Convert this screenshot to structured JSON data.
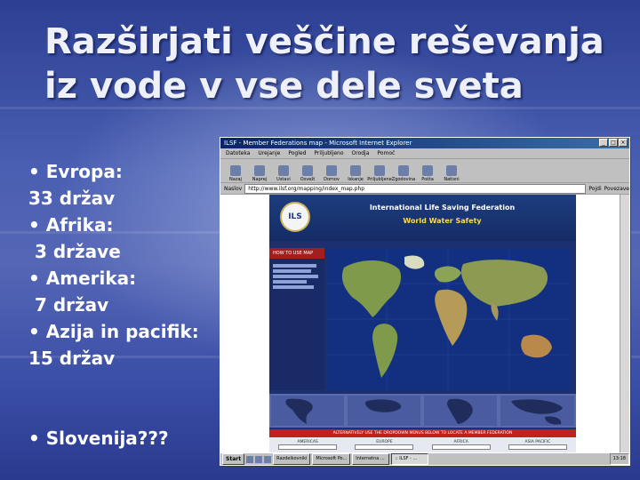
{
  "slide": {
    "title_line1": "Razširjati veščine reševanja",
    "title_line2": "iz vode v vse dele sveta",
    "bullets": [
      "• Evropa:",
      "33 držav",
      "• Afrika:",
      " 3 države",
      "• Amerika:",
      " 7 držav",
      "• Azija in pacifik:",
      "15 držav"
    ],
    "slovenia": "• Slovenija???"
  },
  "browser": {
    "window_title": "ILSF - Member Federations map - Microsoft Internet Explorer",
    "menu": [
      "Datoteka",
      "Urejanje",
      "Pogled",
      "Priljubljeno",
      "Orodja",
      "Pomoč"
    ],
    "toolbar": [
      "Nazaj",
      "Naprej",
      "Ustavi",
      "Osveži",
      "Domov",
      "Iskanje",
      "Priljubljene",
      "Zgodovina",
      "Pošta",
      "Natisni"
    ],
    "address_label": "Naslov",
    "address_value": "http://www.ilsf.org/mapping/index_map.php",
    "go_label": "Pojdi",
    "links_label": "Povezave"
  },
  "site": {
    "logo_text": "ILS",
    "org_name": "International Life Saving Federation",
    "tagline": "World Water Safety",
    "how_to": "HOW TO USE MAP",
    "region_bar": "ALTERNATIVELY USE THE DROPDOWN MENUS BELOW TO LOCATE A MEMBER FEDERATION",
    "regions": [
      "AMERICAS",
      "EUROPE",
      "AFRICA",
      "ASIA PACIFIC"
    ]
  },
  "taskbar": {
    "start": "Start",
    "tasks": [
      "Razdelkovniki",
      "Microsoft Po...",
      "Internetna ...",
      ":: ILSF - ..."
    ],
    "clock": "13:18"
  },
  "colors": {
    "slide_bg": "#3f52a8",
    "title_text": "#eef0fa",
    "site_navy": "#1c2f6e",
    "tagline_yellow": "#ffd84a",
    "picker_red": "#c21f1f"
  }
}
